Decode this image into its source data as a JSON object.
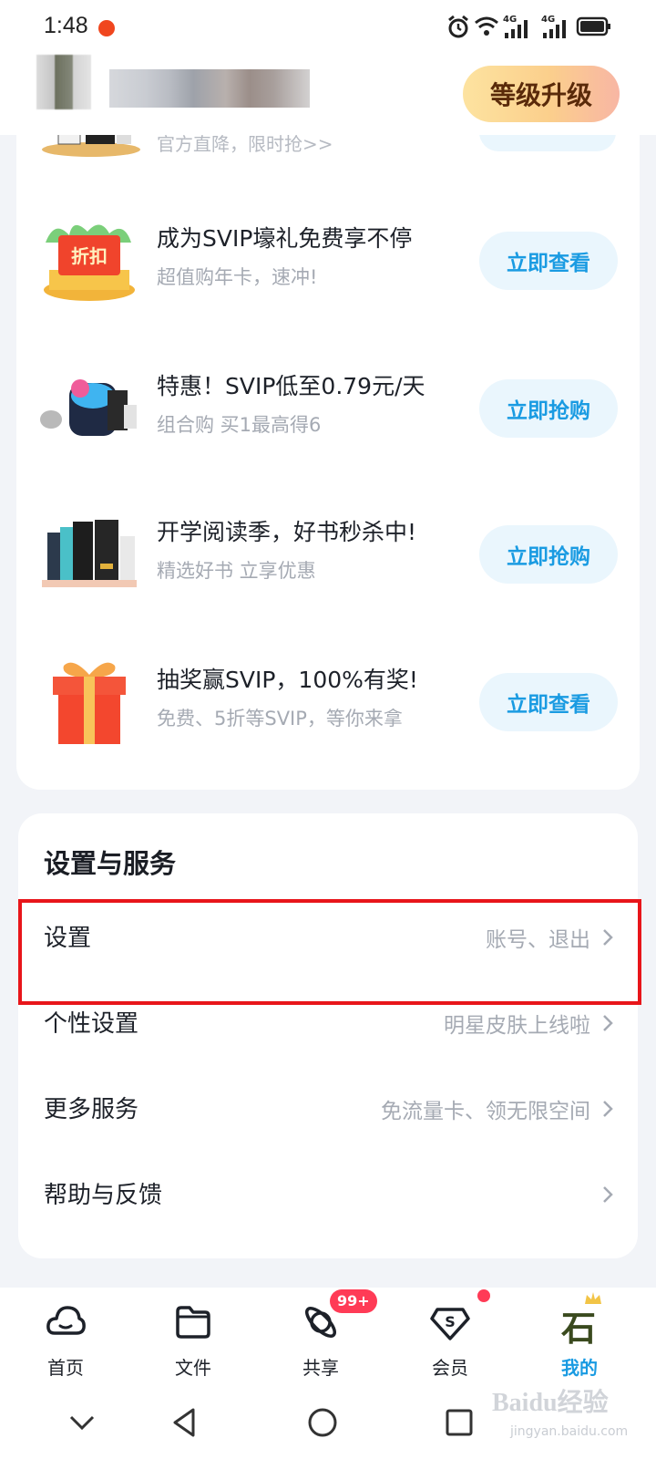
{
  "status_bar": {
    "time": "1:48",
    "network_label_1": "4G",
    "network_label_2": "4G"
  },
  "header": {
    "upgrade_label": "等级升级"
  },
  "promo": {
    "top_partial_text": "官方直降，限时抢>>",
    "items": [
      {
        "title": "成为SVIP壕礼免费享不停",
        "subtitle": "超值购年卡，速冲!",
        "button": "立即查看",
        "thumb_label": "折扣"
      },
      {
        "title": "特惠！SVIP低至0.79元/天",
        "subtitle": "组合购 买1最高得6",
        "button": "立即抢购"
      },
      {
        "title": "开学阅读季，好书秒杀中!",
        "subtitle": "精选好书 立享优惠",
        "button": "立即抢购"
      },
      {
        "title": "抽奖赢SVIP，100%有奖!",
        "subtitle": "免费、5折等SVIP，等你来拿",
        "button": "立即查看"
      }
    ]
  },
  "settings": {
    "section_title": "设置与服务",
    "rows": [
      {
        "label": "设置",
        "hint": "账号、退出"
      },
      {
        "label": "个性设置",
        "hint": "明星皮肤上线啦"
      },
      {
        "label": "更多服务",
        "hint": "免流量卡、领无限空间"
      },
      {
        "label": "帮助与反馈",
        "hint": ""
      }
    ]
  },
  "bottom_nav": {
    "items": [
      {
        "label": "首页"
      },
      {
        "label": "文件"
      },
      {
        "label": "共享",
        "badge": "99+"
      },
      {
        "label": "会员"
      },
      {
        "label": "我的",
        "avatar_char": "石"
      }
    ],
    "active_index": 4
  },
  "watermark": {
    "text": "Baidu经验",
    "sub": "jingyan.baidu.com"
  },
  "colors": {
    "accent": "#1a9be2",
    "highlight": "#e8151a",
    "badge": "#ff3b56"
  }
}
